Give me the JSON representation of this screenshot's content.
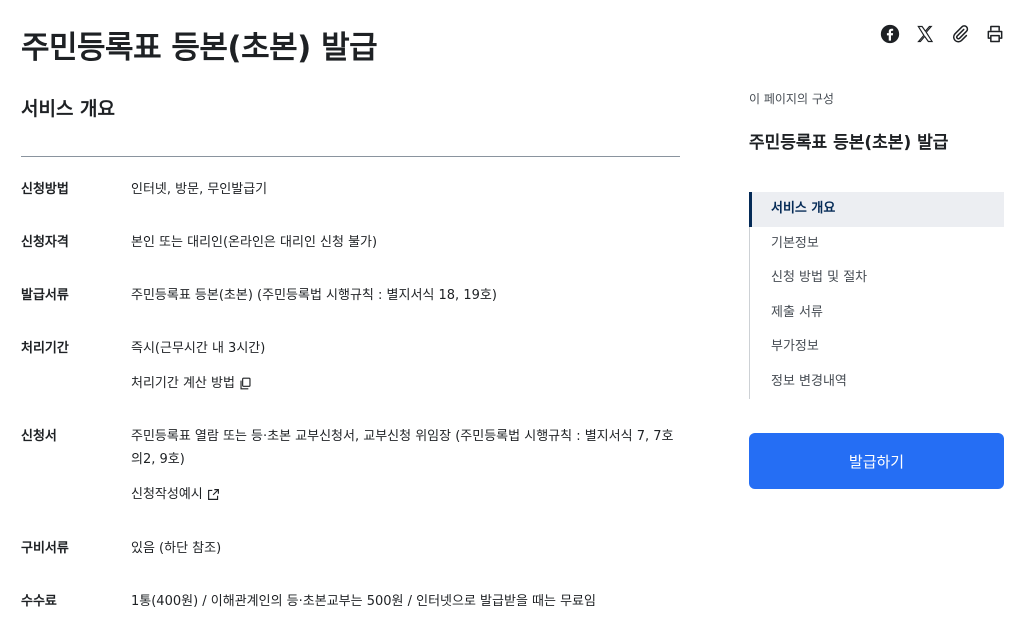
{
  "page": {
    "title": "주민등록표 등본(초본) 발급"
  },
  "share": {
    "icons": [
      "facebook-icon",
      "x-icon",
      "paperclip-icon",
      "printer-icon"
    ]
  },
  "section": {
    "title": "서비스 개요"
  },
  "info": {
    "rows": [
      {
        "label": "신청방법",
        "value": "인터넷, 방문, 무인발급기"
      },
      {
        "label": "신청자격",
        "value": "본인 또는 대리인(온라인은 대리인 신청 불가)"
      },
      {
        "label": "발급서류",
        "value": "주민등록표 등본(초본) (주민등록법 시행규칙 : 별지서식 18, 19호)"
      },
      {
        "label": "처리기간",
        "value": "즉시(근무시간 내 3시간)",
        "link": "처리기간 계산 방법"
      },
      {
        "label": "신청서",
        "value": "주민등록표 열람 또는 등·초본 교부신청서, 교부신청 위임장 (주민등록법 시행규칙 : 별지서식 7, 7호의2, 9호)",
        "link": "신청작성예시"
      },
      {
        "label": "구비서류",
        "value": "있음 (하단 참조)"
      },
      {
        "label": "수수료",
        "value": "1통(400원) / 이해관계인의 등·초본교부는 500원 / 인터넷으로 발급받을 때는 무료임"
      }
    ]
  },
  "toc": {
    "caption": "이 페이지의 구성",
    "title": "주민등록표 등본(초본) 발급",
    "items": [
      "서비스 개요",
      "기본정보",
      "신청 방법 및 절차",
      "제출 서류",
      "부가정보",
      "정보 변경내역"
    ],
    "active_index": 0
  },
  "actions": {
    "issue_label": "발급하기"
  },
  "colors": {
    "primary": "#256ef4",
    "toc_active_bg": "#eceef2",
    "toc_active_text": "#052b57"
  }
}
